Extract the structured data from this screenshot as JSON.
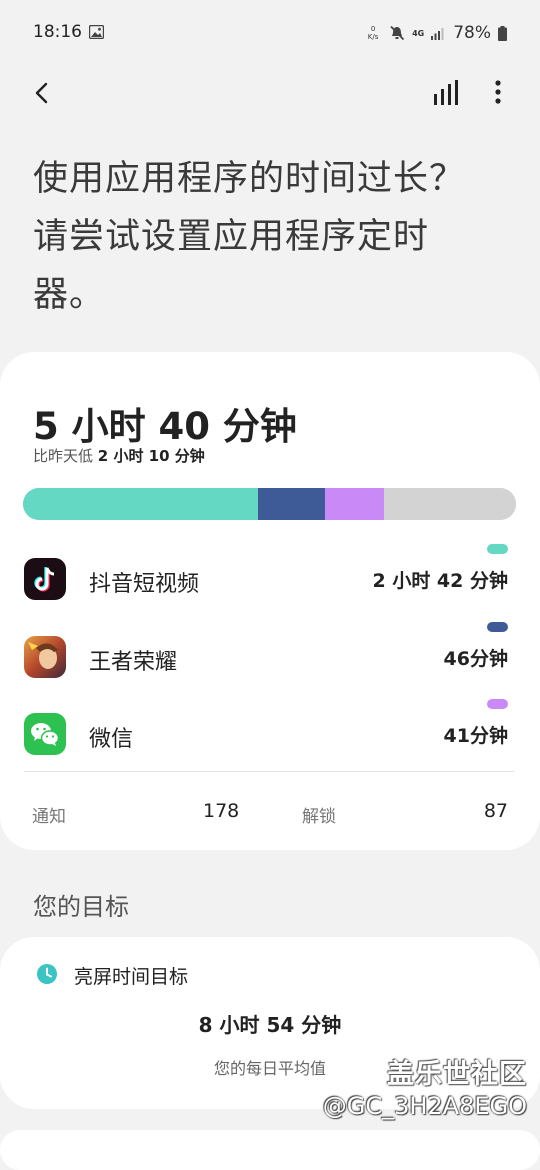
{
  "status_bar": {
    "time": "18:16",
    "net_speed_value": "0",
    "net_speed_unit": "K/s",
    "network_type": "4G",
    "battery": "78%"
  },
  "header": {
    "back_icon": "chevron-left-icon",
    "stats_icon": "bar-chart-icon",
    "more_icon": "more-vertical-icon"
  },
  "headline": "使用应用程序的时间过长？请尝试设置应用程序定时器。",
  "usage": {
    "total": "5 小时 40 分钟",
    "compare_prefix": "比昨天低",
    "compare_value": "2 小时 10 分钟",
    "bar_segments": [
      {
        "app": "抖音短视频",
        "fraction": 0.477,
        "color": "#64d8c2"
      },
      {
        "app": "王者荣耀",
        "fraction": 0.135,
        "color": "#3e5b98"
      },
      {
        "app": "微信",
        "fraction": 0.121,
        "color": "#c98af7"
      },
      {
        "app": "other",
        "fraction": 0.267,
        "color": "#d3d3d3"
      }
    ],
    "apps": [
      {
        "name": "抖音短视频",
        "duration": "2 小时 42 分钟",
        "color": "#64d8c2",
        "icon": "tiktok-icon"
      },
      {
        "name": "王者荣耀",
        "duration": "46分钟",
        "color": "#3e5b98",
        "icon": "honor-of-kings-icon"
      },
      {
        "name": "微信",
        "duration": "41分钟",
        "color": "#c98af7",
        "icon": "wechat-icon"
      }
    ],
    "notifications_label": "通知",
    "notifications_value": "178",
    "unlocks_label": "解锁",
    "unlocks_value": "87"
  },
  "goals": {
    "section_title": "您的目标",
    "goal_label": "亮屏时间目标",
    "goal_value": "8 小时 54 分钟",
    "goal_caption": "您的每日平均值"
  },
  "watermark": {
    "line1": "盖乐世社区",
    "line2": "@GC_3H2A8EGO"
  }
}
